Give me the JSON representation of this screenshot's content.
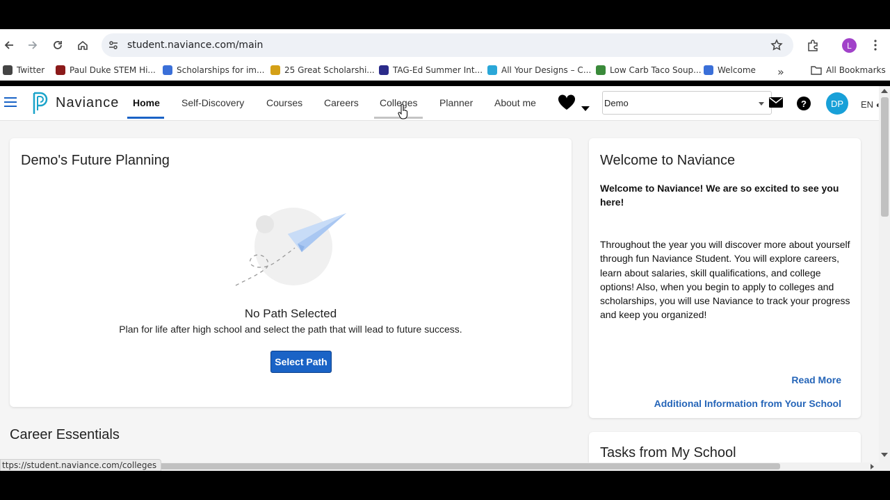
{
  "browser": {
    "url": "student.naviance.com/main",
    "profile_initial": "L",
    "bookmarks": [
      {
        "label": "Twitter",
        "color": "#444444"
      },
      {
        "label": "Paul Duke STEM Hi...",
        "color": "#8b1a1a"
      },
      {
        "label": "Scholarships for im...",
        "color": "#3a6fd8"
      },
      {
        "label": "25 Great Scholarshi...",
        "color": "#d4a017"
      },
      {
        "label": "TAG-Ed Summer Int...",
        "color": "#2b2b8a"
      },
      {
        "label": "All Your Designs – C...",
        "color": "#2aa7d8"
      },
      {
        "label": "Low Carb Taco Soup...",
        "color": "#3a8a3a"
      },
      {
        "label": "Welcome",
        "color": "#3a6fd8"
      }
    ],
    "all_bookmarks_label": "All Bookmarks",
    "status_url": "ttps://student.naviance.com/colleges"
  },
  "nav": {
    "brand": "Naviance",
    "items": [
      "Home",
      "Self-Discovery",
      "Courses",
      "Careers",
      "Colleges",
      "Planner",
      "About me"
    ],
    "active": "Home",
    "hovered": "Colleges",
    "select_value": "Demo",
    "user_initials": "DP",
    "lang": "EN"
  },
  "planning": {
    "title": "Demo's Future Planning",
    "empty_title": "No Path Selected",
    "empty_text": "Plan for life after high school and select the path that will lead to future success.",
    "button": "Select Path"
  },
  "welcome": {
    "title": "Welcome to Naviance",
    "headline": "Welcome to Naviance! We are so excited to see you here!",
    "body": "Throughout the year you will discover more about yourself through fun Naviance Student. You will explore careers, learn about salaries, skill qualifications, and college options! Also, when you begin to apply to colleges and scholarships, you will use Naviance to track your progress and keep you organized!",
    "read_more": "Read More",
    "additional_info": "Additional Information from Your School"
  },
  "career_essentials": {
    "title": "Career Essentials"
  },
  "tasks": {
    "title": "Tasks from My School"
  },
  "colors": {
    "accent": "#1a63c6",
    "link": "#2565b8",
    "avatar": "#18a0d8"
  }
}
